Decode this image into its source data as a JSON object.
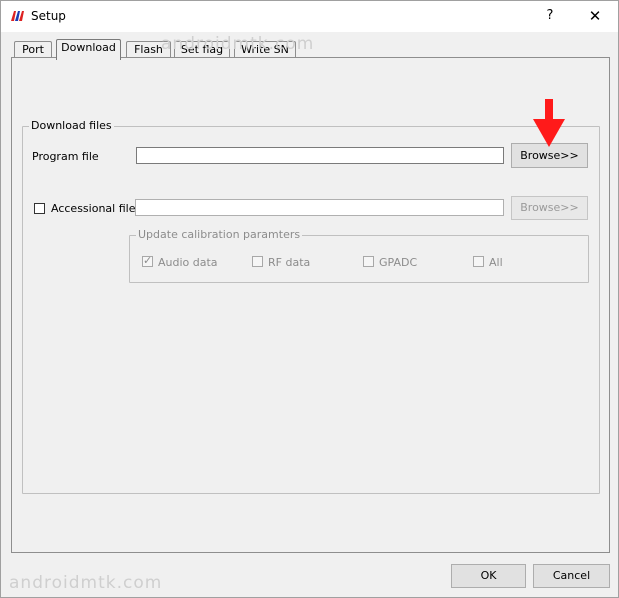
{
  "window": {
    "title": "Setup",
    "help_glyph": "?",
    "close_glyph": "✕"
  },
  "tabs": [
    "Port",
    "Download",
    "Flash",
    "Set flag",
    "Write SN"
  ],
  "download_files": {
    "group_title": "Download files",
    "program_file_label": "Program file",
    "program_file_value": "",
    "browse_label": "Browse>>",
    "accessional_label": "Accessional file",
    "accessional_checked": false,
    "accessional_value": "",
    "accessional_browse_label": "Browse>>"
  },
  "calibration": {
    "group_title": "Update calibration paramters",
    "options": [
      {
        "label": "Audio data",
        "checked": true
      },
      {
        "label": "RF data",
        "checked": false
      },
      {
        "label": "GPADC",
        "checked": false
      },
      {
        "label": "All",
        "checked": false
      }
    ]
  },
  "buttons": {
    "ok": "OK",
    "cancel": "Cancel"
  },
  "watermark": "androidmtk.com",
  "colors": {
    "arrow": "#ff1a1a",
    "logo_red": "#d22",
    "logo_blue": "#1a3bb3"
  }
}
